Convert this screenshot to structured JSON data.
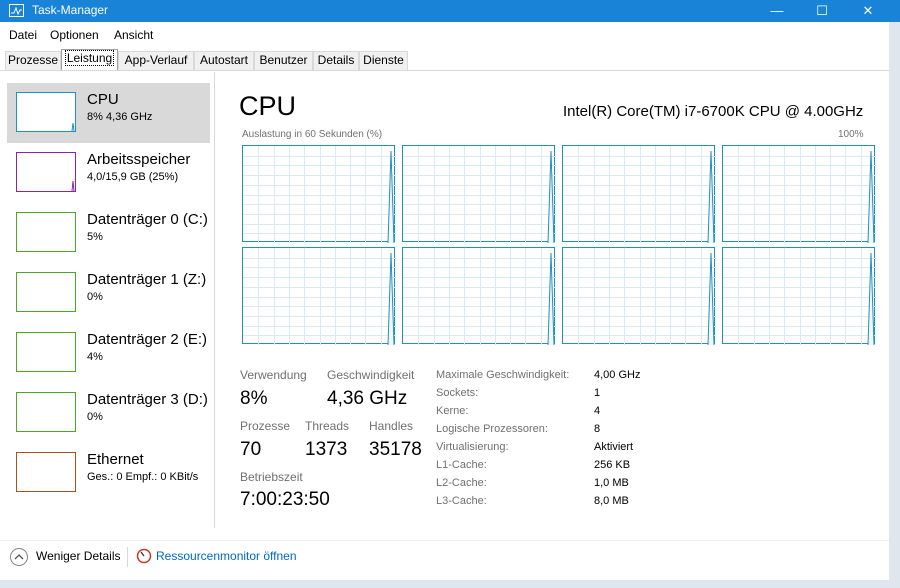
{
  "window": {
    "title": "Task-Manager"
  },
  "menu": [
    "Datei",
    "Optionen",
    "Ansicht"
  ],
  "tabs": [
    "Prozesse",
    "Leistung",
    "App-Verlauf",
    "Autostart",
    "Benutzer",
    "Details",
    "Dienste"
  ],
  "sidebar": {
    "items": [
      {
        "name": "CPU",
        "value": "8% 4,36 GHz",
        "color": "#1f8fc8"
      },
      {
        "name": "Arbeitsspeicher",
        "value": "4,0/15,9 GB (25%)",
        "color": "#8b24a8"
      },
      {
        "name": "Datenträger 0 (C:)",
        "value": "5%",
        "color": "#4da722"
      },
      {
        "name": "Datenträger 1 (Z:)",
        "value": "0%",
        "color": "#4da722"
      },
      {
        "name": "Datenträger 2 (E:)",
        "value": "4%",
        "color": "#4da722"
      },
      {
        "name": "Datenträger 3 (D:)",
        "value": "0%",
        "color": "#4da722"
      },
      {
        "name": "Ethernet",
        "value": "Ges.: 0 Empf.: 0 KBit/s",
        "color": "#a7511d"
      }
    ]
  },
  "main": {
    "title": "CPU",
    "model": "Intel(R) Core(TM) i7-6700K CPU @ 4.00GHz",
    "graph_caption": "Auslastung in 60 Sekunden (%)",
    "graph_max": "100%",
    "cores": 8
  },
  "stats": {
    "usage_label": "Verwendung",
    "usage_value": "8%",
    "speed_label": "Geschwindigkeit",
    "speed_value": "4,36 GHz",
    "processes_label": "Prozesse",
    "processes_value": "70",
    "threads_label": "Threads",
    "threads_value": "1373",
    "handles_label": "Handles",
    "handles_value": "35178",
    "uptime_label": "Betriebszeit",
    "uptime_value": "7:00:23:50"
  },
  "details": [
    {
      "label": "Maximale Geschwindigkeit:",
      "value": "4,00 GHz"
    },
    {
      "label": "Sockets:",
      "value": "1"
    },
    {
      "label": "Kerne:",
      "value": "4"
    },
    {
      "label": "Logische Prozessoren:",
      "value": "8"
    },
    {
      "label": "Virtualisierung:",
      "value": "Aktiviert"
    },
    {
      "label": "L1-Cache:",
      "value": "256 KB"
    },
    {
      "label": "L2-Cache:",
      "value": "1,0 MB"
    },
    {
      "label": "L3-Cache:",
      "value": "8,0 MB"
    }
  ],
  "footer": {
    "fewer_details_label": "Weniger Details",
    "resource_monitor_label": "Ressourcenmonitor öffnen"
  }
}
